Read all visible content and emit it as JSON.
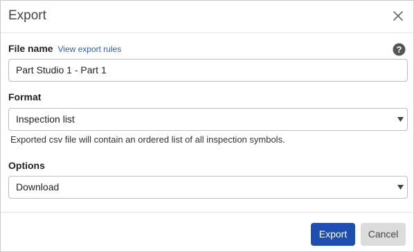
{
  "dialog": {
    "title": "Export",
    "close_icon": "close-icon"
  },
  "file_name": {
    "label": "File name",
    "link_text": "View export rules",
    "help_icon": "help-icon",
    "value": "Part Studio 1 - Part 1"
  },
  "format": {
    "label": "Format",
    "selected": "Inspection list",
    "hint": "Exported csv file will contain an ordered list of all inspection symbols."
  },
  "options": {
    "label": "Options",
    "selected": "Download"
  },
  "buttons": {
    "export_label": "Export",
    "cancel_label": "Cancel"
  },
  "colors": {
    "primary": "#1c4fb0",
    "link": "#2d5fa3",
    "cancel_bg": "#dcdcdc"
  }
}
